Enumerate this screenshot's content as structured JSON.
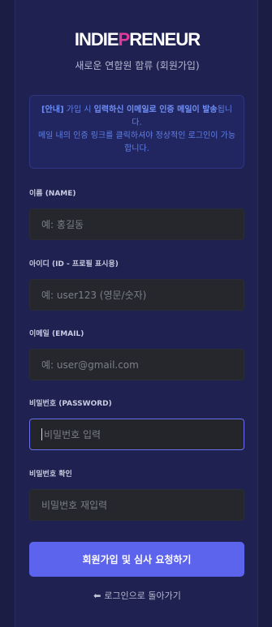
{
  "brand": {
    "part1": "INDIE",
    "accent": "P",
    "part2": "RENEUR",
    "accent_color": "#e0399a"
  },
  "subtitle": "새로운 연합원 합류 (회원가입)",
  "notice": {
    "tag": "[안내]",
    "text1": " 가입 시 ",
    "bold1": "입력하신 이메일로 인증 메일이 발송",
    "text2": "됩니다.",
    "line2": "메일 내의 인증 링크를 클릭하셔야 정상적인 로그인이 가능합니다."
  },
  "form": {
    "name": {
      "label": "이름 (NAME)",
      "placeholder": "예: 홍길동"
    },
    "user_id": {
      "label": "아이디 (ID - 프로필 표시용)",
      "placeholder": "예: user123 (영문/숫자)"
    },
    "email": {
      "label": "이메일 (EMAIL)",
      "placeholder": "예: user@gmail.com"
    },
    "password": {
      "label": "비밀번호 (PASSWORD)",
      "placeholder": "비밀번호 입력"
    },
    "password_confirm": {
      "label": "비밀번호 확인",
      "placeholder": "비밀번호 재입력"
    }
  },
  "submit_label": "회원가입 및 심사 요청하기",
  "back": {
    "icon": "arrow-left-icon",
    "label": "로그인으로 돌아가기"
  },
  "colors": {
    "primary": "#5c63ec",
    "background": "#1f2250",
    "notice_text": "#5f7fe8"
  }
}
